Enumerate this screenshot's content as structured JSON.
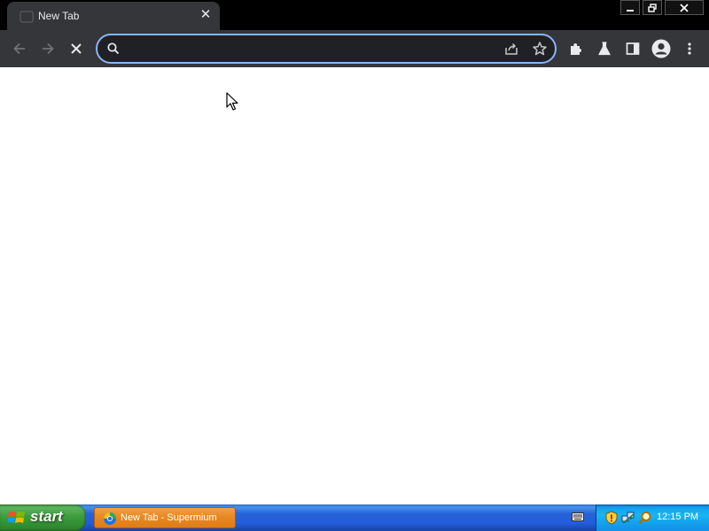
{
  "browser": {
    "tab": {
      "title": "New Tab",
      "close_glyph": "✕"
    },
    "window_controls": [
      "minimize-icon",
      "restore-icon",
      "close-icon"
    ],
    "toolbar": {
      "back_icon": "arrow-left-icon",
      "forward_icon": "arrow-right-icon",
      "stop_icon": "stop-loading-icon",
      "omnibox": {
        "value": "",
        "placeholder": ""
      },
      "right_icons": [
        "extensions-icon",
        "labs-flask-icon",
        "side-panel-icon",
        "profile-avatar-icon",
        "kebab-menu-icon"
      ]
    },
    "colors": {
      "frame": "#000000",
      "toolbar": "#35363a",
      "omnibox_border": "#8ab4f8",
      "content": "#ffffff"
    }
  },
  "taskbar": {
    "start_label": "start",
    "task_item": {
      "label": "New Tab - Supermium",
      "icon": "supermium-icon"
    },
    "tray_icons": [
      "keyboard-icon",
      "security-shield-icon",
      "network-icon",
      "search-icon"
    ],
    "clock": "12:15 PM",
    "colors": {
      "bar": "#245edb",
      "start": "#3d9d3d",
      "task_active": "#e98a25",
      "tray": "#18b5f2"
    }
  }
}
